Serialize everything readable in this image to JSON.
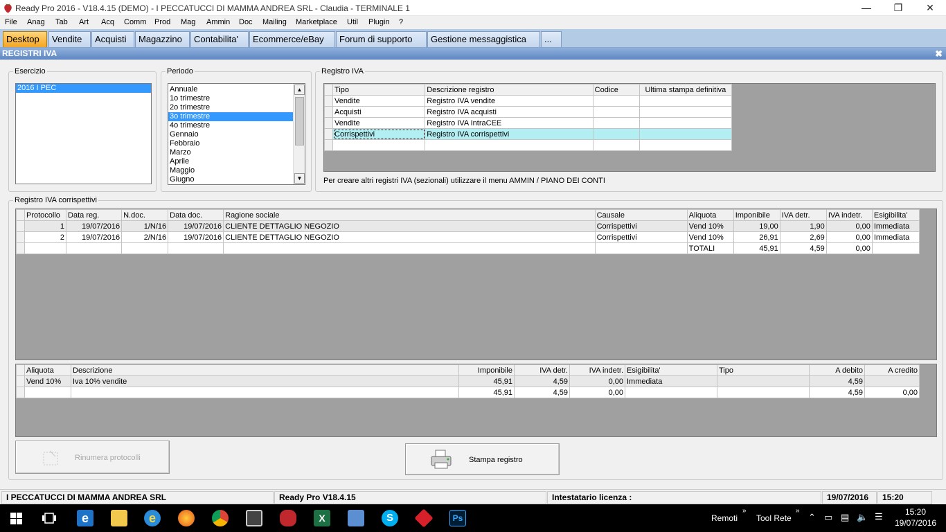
{
  "window": {
    "title": "Ready Pro 2016 - V18.4.15 (DEMO)  - I PECCATUCCI DI MAMMA ANDREA SRL - Claudia - TERMINALE 1"
  },
  "menu": [
    "File",
    "Anag",
    "Tab",
    "Art",
    "Acq",
    "Comm",
    "Prod",
    "Mag",
    "Ammin",
    "Doc",
    "Mailing",
    "Marketplace",
    "Util",
    "Plugin",
    "?"
  ],
  "tabs": [
    "Desktop",
    "Vendite",
    "Acquisti",
    "Magazzino",
    "Contabilita'",
    "Ecommerce/eBay",
    "Forum di supporto",
    "Gestione messaggistica",
    "..."
  ],
  "form": {
    "title": "REGISTRI IVA"
  },
  "esercizio": {
    "label": "Esercizio",
    "items": [
      "2016 I PEC"
    ]
  },
  "periodo": {
    "label": "Periodo",
    "items": [
      "Annuale",
      "1o trimestre",
      "2o trimestre",
      "3o trimestre",
      "4o trimestre",
      "Gennaio",
      "Febbraio",
      "Marzo",
      "Aprile",
      "Maggio",
      "Giugno"
    ],
    "selected": "3o trimestre"
  },
  "registro": {
    "label": "Registro IVA",
    "headers": [
      "Tipo",
      "Descrizione registro",
      "Codice",
      "Ultima stampa definitiva"
    ],
    "rows": [
      [
        "Vendite",
        "Registro IVA vendite",
        "",
        ""
      ],
      [
        "Acquisti",
        "Registro IVA acquisti",
        "",
        ""
      ],
      [
        "Vendite",
        "Registro IVA IntraCEE",
        "",
        ""
      ],
      [
        "Corrispettivi",
        "Registro IVA corrispettivi",
        "",
        ""
      ]
    ],
    "note": "Per creare altri registri IVA (sezionali) utilizzare il menu AMMIN / PIANO DEI CONTI"
  },
  "corrispettivi": {
    "label": "Registro IVA corrispettivi",
    "headers": [
      "Protocollo",
      "Data reg.",
      "N.doc.",
      "Data doc.",
      "Ragione sociale",
      "Causale",
      "Aliquota",
      "Imponibile",
      "IVA detr.",
      "IVA indetr.",
      "Esigibilita'"
    ],
    "rows": [
      [
        "1",
        "19/07/2016",
        "1/N/16",
        "19/07/2016",
        "CLIENTE DETTAGLIO NEGOZIO",
        "Corrispettivi",
        "Vend 10%",
        "19,00",
        "1,90",
        "0,00",
        "Immediata"
      ],
      [
        "2",
        "19/07/2016",
        "2/N/16",
        "19/07/2016",
        "CLIENTE DETTAGLIO NEGOZIO",
        "Corrispettivi",
        "Vend 10%",
        "26,91",
        "2,69",
        "0,00",
        "Immediata"
      ]
    ],
    "totals": {
      "label": "TOTALI",
      "imponibile": "45,91",
      "iva_detr": "4,59",
      "iva_indetr": "0,00"
    }
  },
  "riepilogo": {
    "headers": [
      "Aliquota",
      "Descrizione",
      "Imponibile",
      "IVA detr.",
      "IVA indetr.",
      "Esigibilita'",
      "Tipo",
      "A debito",
      "A credito"
    ],
    "rows": [
      [
        "Vend 10%",
        "Iva 10% vendite",
        "45,91",
        "4,59",
        "0,00",
        "Immediata",
        "",
        "4,59",
        ""
      ],
      [
        "",
        "",
        "45,91",
        "4,59",
        "0,00",
        "",
        "",
        "4,59",
        "0,00"
      ]
    ]
  },
  "buttons": {
    "rinumera": "Rinumera protocolli",
    "stampa": "Stampa registro"
  },
  "status": {
    "company": "I PECCATUCCI DI MAMMA ANDREA SRL",
    "version": "Ready Pro V18.4.15",
    "licenza": "Intestatario licenza :",
    "date": "19/07/2016",
    "time": "15:20"
  },
  "taskbar": {
    "remoti": "Remoti",
    "toolrete": "Tool Rete",
    "time": "15:20",
    "date": "19/07/2016"
  },
  "colors": {
    "tab_active": "#f5a623",
    "header": "#5e86c2",
    "selection": "#3399ff",
    "highlight_row": "#b2eef2"
  }
}
